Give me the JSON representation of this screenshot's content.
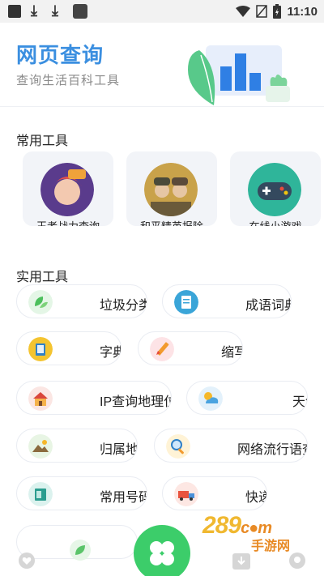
{
  "status_bar": {
    "time": "11:10"
  },
  "header": {
    "title": "网页查询",
    "subtitle": "查询生活百科工具"
  },
  "common_tools": {
    "title": "常用工具",
    "items": [
      {
        "label": "王者战力查询",
        "icon": "hero-avatar-icon"
      },
      {
        "label": "和平精英报除",
        "icon": "soldier-avatar-icon"
      },
      {
        "label": "在线小游戏",
        "icon": "gamepad-icon"
      }
    ]
  },
  "practical_tools": {
    "title": "实用工具",
    "items": [
      {
        "label": "垃圾分类",
        "icon": "leaves-icon"
      },
      {
        "label": "成语词典",
        "icon": "document-icon"
      },
      {
        "label": "字典",
        "icon": "book-icon"
      },
      {
        "label": "缩写",
        "icon": "pencil-icon"
      },
      {
        "label": "IP查询地理位",
        "icon": "house-icon"
      },
      {
        "label": "天气",
        "icon": "weather-icon"
      },
      {
        "label": "归属地",
        "icon": "landscape-icon"
      },
      {
        "label": "网络流行语查",
        "icon": "magnifier-icon"
      },
      {
        "label": "常用号码",
        "icon": "phone-book-icon"
      },
      {
        "label": "快递",
        "icon": "truck-icon"
      }
    ]
  },
  "watermark": {
    "brand": "289",
    "domain": "c●m",
    "sub": "手游网"
  },
  "colors": {
    "accent": "#3b8fe0",
    "fab": "#3ccd6a",
    "pill_border": "#e9ecf2"
  }
}
